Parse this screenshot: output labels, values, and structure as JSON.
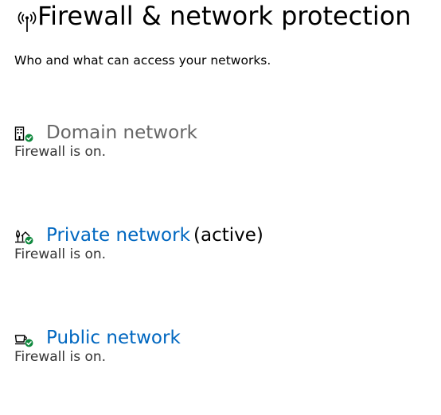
{
  "header": {
    "icon": "wifi-antenna-icon",
    "title": "Firewall & network protection",
    "subtitle": "Who and what can access your networks."
  },
  "networks": [
    {
      "icon": "domain-building-icon",
      "badge_color": "#10893e",
      "name": "Domain network",
      "active_label": "",
      "status": "Firewall is on."
    },
    {
      "icon": "private-home-icon",
      "badge_color": "#10893e",
      "name": "Private network",
      "active_label": "(active)",
      "status": "Firewall is on."
    },
    {
      "icon": "public-coffee-cup-icon",
      "badge_color": "#10893e",
      "name": "Public network",
      "active_label": "",
      "status": "Firewall is on."
    }
  ],
  "colors": {
    "link": "#0067c0",
    "disabled_link": "#666666",
    "text": "#000000",
    "secondary_text": "#333333"
  }
}
